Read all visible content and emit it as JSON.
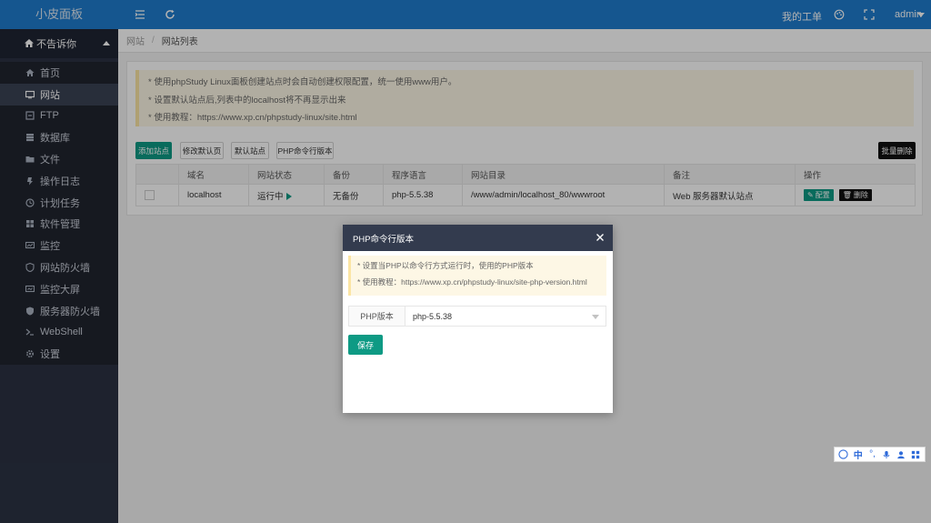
{
  "brand": "小皮面板",
  "sidebar": {
    "user": "不告诉你",
    "items": [
      {
        "label": "首页",
        "icon": "home-icon"
      },
      {
        "label": "网站",
        "icon": "monitor-icon",
        "active": true
      },
      {
        "label": "FTP",
        "icon": "ftp-icon"
      },
      {
        "label": "数据库",
        "icon": "database-icon"
      },
      {
        "label": "文件",
        "icon": "folder-icon"
      },
      {
        "label": "操作日志",
        "icon": "log-icon"
      },
      {
        "label": "计划任务",
        "icon": "clock-icon"
      },
      {
        "label": "软件管理",
        "icon": "grid-icon"
      },
      {
        "label": "监控",
        "icon": "monitor-chart-icon"
      },
      {
        "label": "网站防火墙",
        "icon": "shield-icon"
      },
      {
        "label": "监控大屏",
        "icon": "screen-icon"
      },
      {
        "label": "服务器防火墙",
        "icon": "shield-check-icon"
      },
      {
        "label": "WebShell",
        "icon": "terminal-icon"
      },
      {
        "label": "设置",
        "icon": "gear-icon"
      }
    ]
  },
  "topbar": {
    "my_tickets": "我的工单",
    "user": "admin"
  },
  "breadcrumb": {
    "root": "网站",
    "current": "网站列表"
  },
  "notice": {
    "lines": [
      "* 使用phpStudy Linux面板创建站点时会自动创建权限配置，统一使用www用户。",
      "* 设置默认站点后,列表中的localhost将不再显示出来",
      "* 使用教程：https://www.xp.cn/phpstudy-linux/site.html"
    ]
  },
  "toolbar": {
    "add_site": "添加站点",
    "edit_default_page": "修改默认页",
    "default_site": "默认站点",
    "php_cli_version": "PHP命令行版本",
    "batch_delete": "批量删除"
  },
  "table": {
    "headers": [
      "",
      "域名",
      "网站状态",
      "备份",
      "程序语言",
      "网站目录",
      "备注",
      "操作"
    ],
    "rows": [
      {
        "domain": "localhost",
        "status": "运行中",
        "backup": "无备份",
        "language": "php-5.5.38",
        "dir": "/www/admin/localhost_80/wwwroot",
        "note": "Web 服务器默认站点",
        "config": "配置",
        "delete": "删除"
      }
    ]
  },
  "modal": {
    "title": "PHP命令行版本",
    "notice": [
      "* 设置当PHP以命令行方式运行时，使用的PHP版本",
      "* 使用教程：https://www.xp.cn/phpstudy-linux/site-php-version.html"
    ],
    "field_label": "PHP版本",
    "field_value": "php-5.5.38",
    "save": "保存"
  },
  "ime": {
    "lang": "中"
  },
  "colors": {
    "topbar": "#1f7ccd",
    "sidebar": "#2b3243",
    "accent_green": "#0e9a84",
    "modal_header": "#333b4e"
  }
}
